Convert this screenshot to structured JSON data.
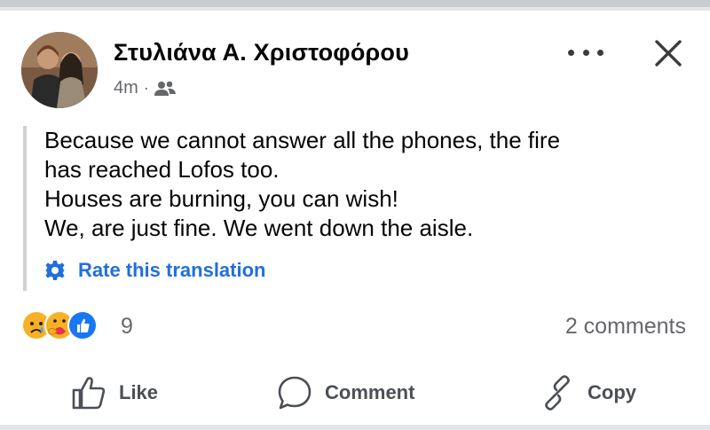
{
  "post": {
    "author": "Στυλιάνα Α. Χριστοφόρου",
    "time": "4m",
    "separator": "·",
    "audience_icon": "friends-icon",
    "text_lines": [
      "Because we cannot answer all the phones, the fire",
      "has reached Lofos too.",
      "Houses are burning, you can wish!",
      "We, are just fine. We went down the aisle."
    ],
    "rate_translation": "Rate this translation"
  },
  "reactions": {
    "icons": [
      "sad-reaction-icon",
      "care-reaction-icon",
      "like-reaction-icon"
    ],
    "count": "9",
    "comments": "2 comments"
  },
  "actions": {
    "like": "Like",
    "comment": "Comment",
    "copy": "Copy"
  },
  "colors": {
    "link_blue": "#216fdb",
    "secondary_text": "#65676b",
    "like_blue": "#1877f2"
  }
}
